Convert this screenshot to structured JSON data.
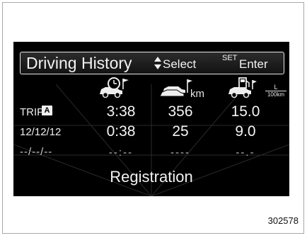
{
  "header": {
    "title": "Driving History",
    "select_icon": "up-down-triangles-icon",
    "select_label": "Select",
    "set_label": "SET",
    "enter_label": "Enter"
  },
  "columns": [
    {
      "icon": "car-clock-flag-icon"
    },
    {
      "icon": "cars-distance-flag-icon",
      "unit": "km"
    },
    {
      "icon": "car-fuel-pump-icon",
      "unit_num": "L",
      "unit_den": "100km"
    }
  ],
  "rows": [
    {
      "label": "TRIP",
      "badge": "A",
      "values": [
        "3:38",
        "356",
        "15.0"
      ]
    },
    {
      "label": "12/12/12",
      "values": [
        "0:38",
        "25",
        "9.0"
      ]
    },
    {
      "label": "--/--/--",
      "values": [
        "--:--",
        "----",
        "--.-"
      ]
    }
  ],
  "footer": {
    "registration_label": "Registration"
  },
  "figure_id": "302578",
  "colors": {
    "screen": "#000000",
    "text": "#f2f2f2",
    "page": "#ffffff"
  }
}
